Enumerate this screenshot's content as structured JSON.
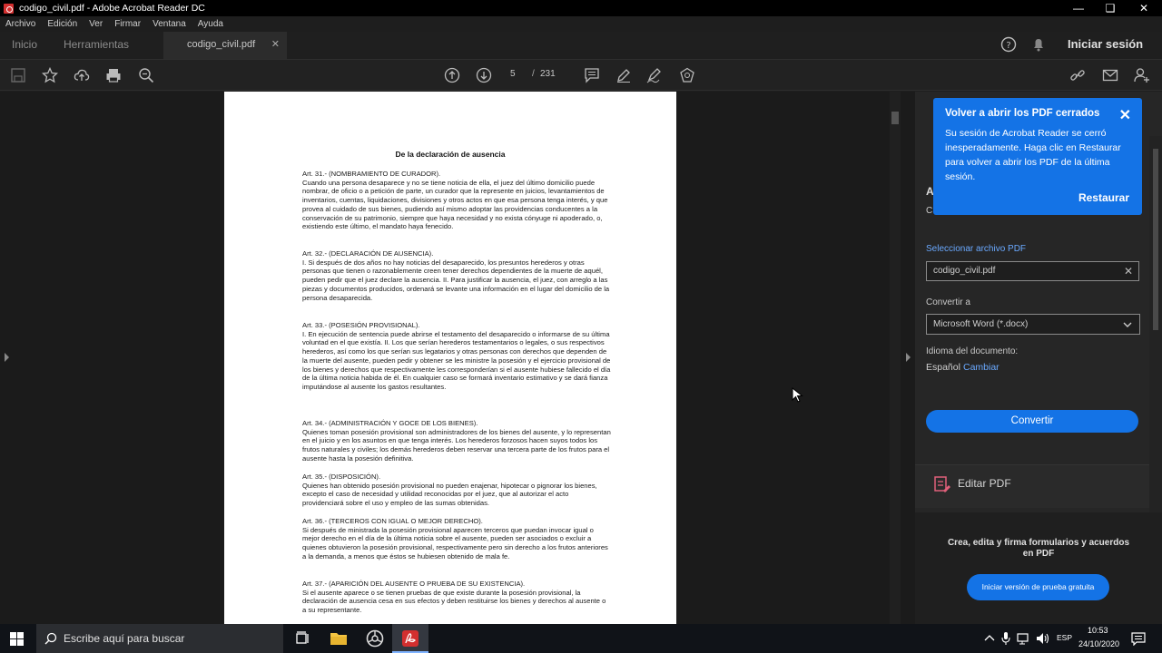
{
  "window": {
    "title": "codigo_civil.pdf - Adobe Acrobat Reader DC"
  },
  "menu": [
    "Archivo",
    "Edición",
    "Ver",
    "Firmar",
    "Ventana",
    "Ayuda"
  ],
  "tabs": {
    "home": "Inicio",
    "tools": "Herramientas",
    "document": "codigo_civil.pdf"
  },
  "header": {
    "signin": "Iniciar sesión"
  },
  "toolbar": {
    "page_current": "5",
    "page_separator": "/",
    "page_total": "231"
  },
  "document": {
    "heading": "De la declaración de ausencia",
    "articles": [
      {
        "title": "Art. 31.- (NOMBRAMIENTO DE CURADOR).",
        "body": "Cuando una persona desaparece y no se tiene noticia de ella, el juez del último domicilio puede nombrar, de oficio o a petición de parte, un curador que la represente en juicios, levantamientos de inventarios, cuentas, liquidaciones, divisiones y otros actos en que esa persona tenga interés, y que provea al cuidado de sus bienes, pudiendo así mismo adoptar las providencias conducentes a la conservación de su patrimonio, siempre que haya necesidad y no exista cónyuge ni apoderado, o, existiendo este último, el mandato haya fenecido."
      },
      {
        "title": "Art. 32.- (DECLARACIÓN DE AUSENCIA).",
        "body": "I. Si después de dos años no hay noticias del desaparecido, los presuntos herederos y otras personas que tienen o razonablemente creen tener derechos dependientes de la muerte de aquél, pueden pedir que el juez declare la ausencia. II. Para justificar la ausencia, el juez, con arreglo a las piezas y documentos producidos, ordenará se levante una información en el lugar del domicilio de la persona desaparecida."
      },
      {
        "title": "Art. 33.- (POSESIÓN PROVISIONAL).",
        "body": "I. En ejecución de sentencia puede abrirse el testamento del desaparecido o informarse de su última voluntad en el que existía. II. Los que serían herederos testamentarios o legales, o sus respectivos herederos, así como los que serían sus legatarios y otras personas con derechos que dependen de la muerte del ausente, pueden pedir y obtener se les ministre la posesión y el ejercicio provisional de los bienes y derechos que respectivamente les corresponderían si el ausente hubiese fallecido el día de la última noticia habida de él. En cualquier caso se formará inventario estimativo y se dará fianza imputándose al ausente los gastos resultantes."
      },
      {
        "title": "Art. 34.- (ADMINISTRACIÓN Y GOCE DE LOS BIENES).",
        "body": "Quienes toman posesión provisional son administradores de los bienes del ausente, y lo representan en el juicio y en los asuntos en que tenga interés. Los herederos forzosos hacen suyos todos los frutos naturales y civiles; los demás herederos deben reservar una tercera parte de los frutos para el ausente hasta la posesión definitiva."
      },
      {
        "title": "Art. 35.- (DISPOSICIÓN).",
        "body": "Quienes han obtenido posesión provisional no pueden enajenar, hipotecar o pignorar los bienes, excepto el caso de necesidad y utilidad reconocidas por el juez, que al autorizar el acto providenciará sobre el uso y empleo de las sumas obtenidas."
      },
      {
        "title": "Art. 36.- (TERCEROS CON IGUAL O MEJOR DERECHO).",
        "body": "Si después de ministrada la posesión provisional aparecen terceros que puedan invocar igual o mejor derecho en el día de la última noticia sobre el ausente, pueden ser asociados o excluir a quienes obtuvieron la posesión provisional, respectivamente pero sin derecho a los frutos anteriores a la demanda, a menos que éstos se hubiesen obtenido de mala fe."
      },
      {
        "title": "Art. 37.- (APARICIÓN DEL AUSENTE O PRUEBA DE SU EXISTENCIA).",
        "body": "Si el ausente aparece o se tienen pruebas de que existe durante la posesión provisional, la declaración de ausencia cesa en sus efectos y deben restituirse los bienes y derechos al ausente o a su representante."
      }
    ]
  },
  "popup": {
    "title": "Volver a abrir los PDF cerrados",
    "body": "Su sesión de Acrobat Reader se cerró inesperadamente. Haga clic en Restaurar para volver a abrir los PDF de la última sesión.",
    "restore": "Restaurar"
  },
  "panel": {
    "partial_heading": "A",
    "partial_text": "C",
    "select_file_label": "Seleccionar archivo PDF",
    "file_value": "codigo_civil.pdf",
    "convert_to_label": "Convertir a",
    "format_value": "Microsoft Word (*.docx)",
    "language_label": "Idioma del documento:",
    "language_value": "Español",
    "language_change": "Cambiar",
    "convert_button": "Convertir",
    "edit_pdf": "Editar PDF"
  },
  "promo": {
    "text": "Crea, edita y firma formularios y acuerdos en PDF",
    "button": "Iniciar versión de prueba gratuita"
  },
  "taskbar": {
    "search_placeholder": "Escribe aquí para buscar",
    "language": "ESP",
    "time": "10:53",
    "date": "24/10/2020"
  },
  "colors": {
    "accent": "#1473e6",
    "link": "#6aa9ff",
    "background": "#1e1e1e"
  }
}
